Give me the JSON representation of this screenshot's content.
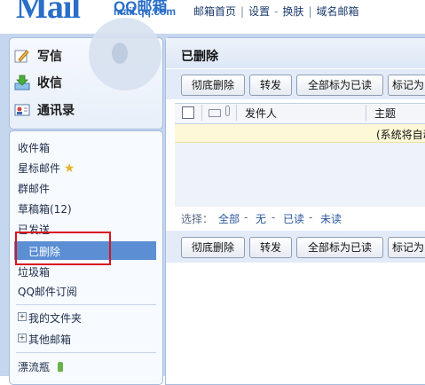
{
  "header": {
    "logo_big": "Mail",
    "logo_brand": "QQ邮箱",
    "logo_domain": "mail.qq.com",
    "nav": [
      "邮箱首页",
      "设置",
      "换肤",
      "域名邮箱"
    ],
    "nav_separators": [
      "|",
      "-",
      "|"
    ]
  },
  "compose": {
    "write": "写信",
    "receive": "收信",
    "contacts": "通讯录"
  },
  "folders": {
    "inbox": "收件箱",
    "starred": "星标邮件",
    "group": "群邮件",
    "drafts": "草稿箱(12)",
    "sent": "已发送",
    "deleted": "已删除",
    "junk": "垃圾箱",
    "subscriptions": "QQ邮件订阅",
    "my_folders": "我的文件夹",
    "other_mailboxes": "其他邮箱",
    "drift_bottle": "漂流瓶",
    "expander_symbol": "+"
  },
  "main": {
    "title": "已删除",
    "toolbar": {
      "delete_permanently": "彻底删除",
      "forward": "转发",
      "mark_all_read": "全部标为已读",
      "mark_as": "标记为"
    },
    "columns": {
      "from": "发件人",
      "subject": "主题"
    },
    "notice": "(系统将自动",
    "select": {
      "label": "选择：",
      "all": "全部",
      "none": "无",
      "read": "已读",
      "unread": "未读",
      "separator": "-"
    }
  },
  "colors": {
    "brand": "#2a6ec8",
    "selected_folder": "#5b8ed3",
    "highlight_box": "#d8141e",
    "page_background": "#c5d6ef"
  }
}
